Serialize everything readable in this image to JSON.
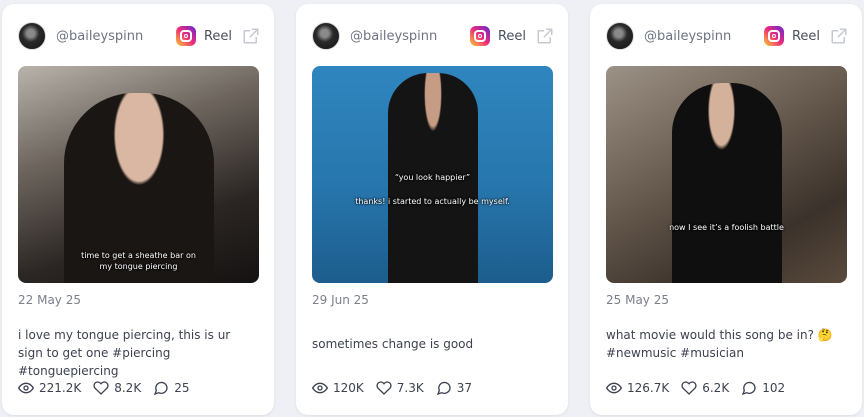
{
  "cards": [
    {
      "username": "@baileyspinn",
      "platform_label": "Reel",
      "platform_icon": "instagram-icon",
      "caption_overlay": "time to get a sheathe bar on\nmy tongue piercing",
      "date": "22 May 25",
      "description": "i love my tongue piercing, this is ur sign to get one #piercing #tonguepiercing",
      "views": "221.2K",
      "likes": "8.2K",
      "comments": "25"
    },
    {
      "username": "@baileyspinn",
      "platform_label": "Reel",
      "platform_icon": "instagram-icon",
      "caption_overlay_1": "“you look happier”",
      "caption_overlay_2": "thanks! i started to actually be myself.",
      "date": "29 Jun 25",
      "description": "sometimes change is good",
      "views": "120K",
      "likes": "7.3K",
      "comments": "37"
    },
    {
      "username": "@baileyspinn",
      "platform_label": "Reel",
      "platform_icon": "instagram-icon",
      "caption_overlay": "now I see it’s a foolish battle",
      "date": "25 May 25",
      "description": "what movie would this song be in? 🤔 #newmusic #musician",
      "views": "126.7K",
      "likes": "6.2K",
      "comments": "102"
    }
  ]
}
